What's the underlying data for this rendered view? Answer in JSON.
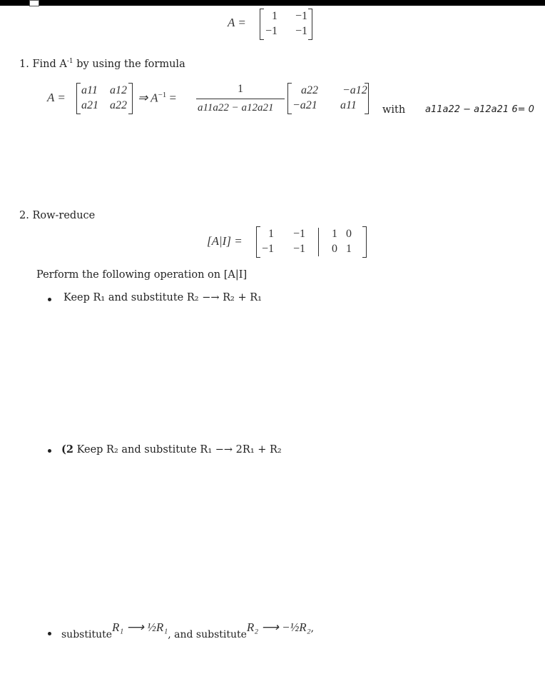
{
  "matrix_A": {
    "label": "A =",
    "cells": [
      [
        "1",
        "−1"
      ],
      [
        "−1",
        "−1"
      ]
    ]
  },
  "section1": {
    "heading": "1. Find A",
    "heading_sup": "-1",
    "heading_rest": " by using the formula",
    "lhs": "A =",
    "gen_cells": [
      [
        "a11",
        "a12"
      ],
      [
        "a21",
        "a22"
      ]
    ],
    "implies": "⇒ A",
    "inv_sup": "−1",
    "equals": "=",
    "numerator": "1",
    "denominator": "a11a22 − a12a21",
    "adj_cells": [
      [
        "a22",
        "−a12"
      ],
      [
        "−a21",
        "a11"
      ]
    ],
    "with": "with",
    "condition": "a11a22 − a12a21 6= 0"
  },
  "section2": {
    "heading": "2. Row-reduce",
    "aug_label": "[A|I] =",
    "aug_left": [
      [
        "1",
        "−1"
      ],
      [
        "−1",
        "−1"
      ]
    ],
    "aug_right": [
      [
        "1",
        "0"
      ],
      [
        "0",
        "1"
      ]
    ],
    "perform": "Perform the following operation on [A|I]",
    "bullets": [
      "Keep R₁ and substitute R₂ −→ R₂ + R₁",
      "Keep R₂ and substitute R₁ −→ 2R₁ + R₂",
      "substitute"
    ],
    "bullet2_prefix": "(2",
    "bullet3": {
      "part1": "substitute",
      "expr1": "R₁ ⟶ ½R₁",
      "part2": ", and substitute",
      "expr2": "R₂ ⟶ −½R₂",
      "end": ","
    }
  }
}
